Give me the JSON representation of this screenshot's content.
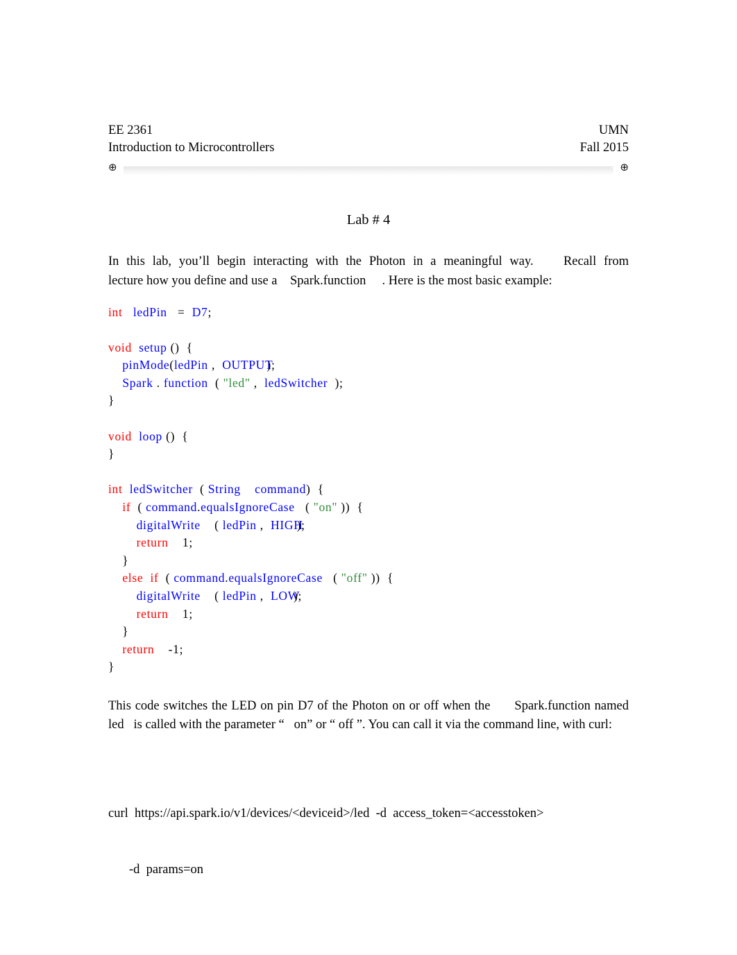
{
  "header": {
    "course_code": "EE 2361",
    "institution": "UMN",
    "course_title": "Introduction to Microcontrollers",
    "term": "Fall 2015",
    "anchor_glyph_left": "⊕",
    "anchor_glyph_right": "⊕"
  },
  "title": "Lab # 4",
  "intro_paragraph": "In  this  lab,  you’ll  begin  interacting  with  the  Photon  in  a  meaningful  way.        Recall  from lecture how you define and use a    Spark.function     . Here is the most basic example:",
  "code": {
    "lines": [
      {
        "id": "l01",
        "tokens": [
          {
            "t": "int",
            "c": "kw"
          },
          {
            "t": "   ",
            "c": "pn"
          },
          {
            "t": "ledPin",
            "c": "id"
          },
          {
            "t": "   =  ",
            "c": "pn"
          },
          {
            "t": "D7",
            "c": "id"
          },
          {
            "t": ";",
            "c": "pn"
          }
        ]
      },
      {
        "id": "l02",
        "tokens": []
      },
      {
        "id": "l03",
        "tokens": [
          {
            "t": "void",
            "c": "kw"
          },
          {
            "t": "  ",
            "c": "pn"
          },
          {
            "t": "setup",
            "c": "id"
          },
          {
            "t": " ()  {",
            "c": "pn"
          }
        ]
      },
      {
        "id": "l04",
        "tokens": [
          {
            "t": "    ",
            "c": "pn"
          },
          {
            "t": "pinMode",
            "c": "id"
          },
          {
            "t": "(",
            "c": "pn"
          },
          {
            "t": "ledPin",
            "c": "id"
          },
          {
            "t": " ,  ",
            "c": "pn"
          },
          {
            "t": "OUTPUT",
            "c": "id"
          },
          {
            "t": ");",
            "c": "ov"
          }
        ]
      },
      {
        "id": "l05",
        "tokens": [
          {
            "t": "    ",
            "c": "pn"
          },
          {
            "t": "Spark",
            "c": "id"
          },
          {
            "t": " . ",
            "c": "pn"
          },
          {
            "t": "function",
            "c": "id"
          },
          {
            "t": "  ( ",
            "c": "pn"
          },
          {
            "t": "\"led\"",
            "c": "str"
          },
          {
            "t": " ,  ",
            "c": "pn"
          },
          {
            "t": "ledSwitcher",
            "c": "id"
          },
          {
            "t": "  );",
            "c": "pn"
          }
        ]
      },
      {
        "id": "l06",
        "tokens": [
          {
            "t": "}",
            "c": "pn"
          }
        ]
      },
      {
        "id": "l07",
        "tokens": []
      },
      {
        "id": "l08",
        "tokens": [
          {
            "t": "void",
            "c": "kw"
          },
          {
            "t": "  ",
            "c": "pn"
          },
          {
            "t": "loop",
            "c": "id"
          },
          {
            "t": " ()  {",
            "c": "pn"
          }
        ]
      },
      {
        "id": "l09",
        "tokens": [
          {
            "t": "}",
            "c": "pn"
          }
        ]
      },
      {
        "id": "l10",
        "tokens": []
      },
      {
        "id": "l11",
        "tokens": [
          {
            "t": "int",
            "c": "kw"
          },
          {
            "t": "  ",
            "c": "pn"
          },
          {
            "t": "ledSwitcher",
            "c": "id"
          },
          {
            "t": "  ( ",
            "c": "pn"
          },
          {
            "t": "String",
            "c": "id"
          },
          {
            "t": "    ",
            "c": "pn"
          },
          {
            "t": "command",
            "c": "id"
          },
          {
            "t": ")  {",
            "c": "pn"
          }
        ]
      },
      {
        "id": "l12",
        "tokens": [
          {
            "t": "    ",
            "c": "pn"
          },
          {
            "t": "if",
            "c": "kw"
          },
          {
            "t": "  ( ",
            "c": "pn"
          },
          {
            "t": "command",
            "c": "id"
          },
          {
            "t": ".",
            "c": "pn"
          },
          {
            "t": "equalsIgnoreCase",
            "c": "id"
          },
          {
            "t": "   ( ",
            "c": "pn"
          },
          {
            "t": "\"on\"",
            "c": "str"
          },
          {
            "t": " ))  {",
            "c": "pn"
          }
        ]
      },
      {
        "id": "l13",
        "tokens": [
          {
            "t": "        ",
            "c": "pn"
          },
          {
            "t": "digitalWrite",
            "c": "id"
          },
          {
            "t": "    ( ",
            "c": "pn"
          },
          {
            "t": "ledPin",
            "c": "id"
          },
          {
            "t": " ,  ",
            "c": "pn"
          },
          {
            "t": "HIGH",
            "c": "id"
          },
          {
            "t": ");",
            "c": "ov"
          }
        ]
      },
      {
        "id": "l14",
        "tokens": [
          {
            "t": "        ",
            "c": "pn"
          },
          {
            "t": "return",
            "c": "kw"
          },
          {
            "t": "    1;",
            "c": "pn"
          }
        ]
      },
      {
        "id": "l15",
        "tokens": [
          {
            "t": "    }",
            "c": "pn"
          }
        ]
      },
      {
        "id": "l16",
        "tokens": [
          {
            "t": "    ",
            "c": "pn"
          },
          {
            "t": "else",
            "c": "kw"
          },
          {
            "t": "  ",
            "c": "pn"
          },
          {
            "t": "if",
            "c": "kw"
          },
          {
            "t": "  ( ",
            "c": "pn"
          },
          {
            "t": "command",
            "c": "id"
          },
          {
            "t": ".",
            "c": "pn"
          },
          {
            "t": "equalsIgnoreCase",
            "c": "id"
          },
          {
            "t": "   ( ",
            "c": "pn"
          },
          {
            "t": "\"off\"",
            "c": "str"
          },
          {
            "t": " ))  {",
            "c": "pn"
          }
        ]
      },
      {
        "id": "l17",
        "tokens": [
          {
            "t": "        ",
            "c": "pn"
          },
          {
            "t": "digitalWrite",
            "c": "id"
          },
          {
            "t": "    ( ",
            "c": "pn"
          },
          {
            "t": "ledPin",
            "c": "id"
          },
          {
            "t": " ,  ",
            "c": "pn"
          },
          {
            "t": "LOW",
            "c": "id"
          },
          {
            "t": ");",
            "c": "ov"
          }
        ]
      },
      {
        "id": "l18",
        "tokens": [
          {
            "t": "        ",
            "c": "pn"
          },
          {
            "t": "return",
            "c": "kw"
          },
          {
            "t": "    1;",
            "c": "pn"
          }
        ]
      },
      {
        "id": "l19",
        "tokens": [
          {
            "t": "    }",
            "c": "pn"
          }
        ]
      },
      {
        "id": "l20",
        "tokens": [
          {
            "t": "    ",
            "c": "pn"
          },
          {
            "t": "return",
            "c": "kw"
          },
          {
            "t": "    -1;",
            "c": "pn"
          }
        ]
      },
      {
        "id": "l21",
        "tokens": [
          {
            "t": "}",
            "c": "pn"
          }
        ]
      }
    ]
  },
  "explanation_paragraph": "This code switches the LED on pin D7 of the Photon on or off when the      Spark.function named  led   is called with the parameter “   on” or “ off ”. You can call it via the command line, with curl:",
  "curl": {
    "line1": "curl  https://api.spark.io/v1/devices/<deviceid>/led  -d  access_token=<accesstoken>",
    "line2": "-d  params=on"
  },
  "colors": {
    "keyword": "#ff0000",
    "identifier": "#0000ff",
    "string": "#2e8b38",
    "punctuation": "#000000",
    "page_background": "#ffffff",
    "rule_band": "#eeeeee"
  }
}
